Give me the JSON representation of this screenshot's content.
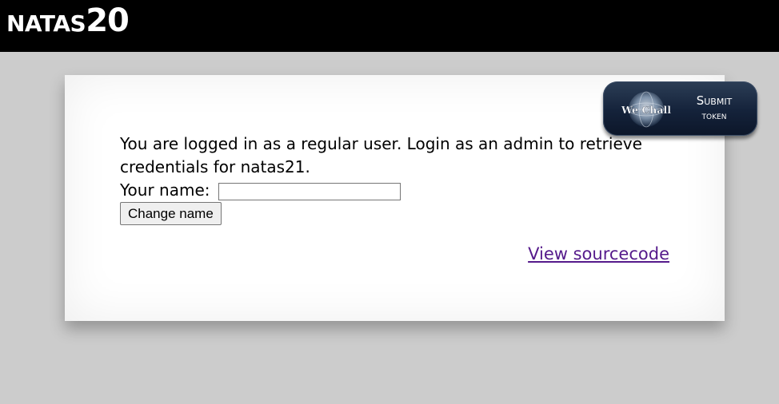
{
  "header": {
    "title_prefix": "NATAS",
    "title_number": "20"
  },
  "main": {
    "message": "You are logged in as a regular user. Login as an admin to retrieve credentials for natas21.",
    "name_label": "Your name:",
    "name_input_value": "",
    "change_name_label": "Change name",
    "source_link_label": "View sourcecode"
  },
  "wechall": {
    "logo_text": "We Chall",
    "line1": "Submit",
    "line2": "token"
  },
  "colors": {
    "header_bg": "#000000",
    "page_bg": "#cccccc",
    "link_visited": "#551a8b",
    "badge_bg": "#14223a"
  }
}
